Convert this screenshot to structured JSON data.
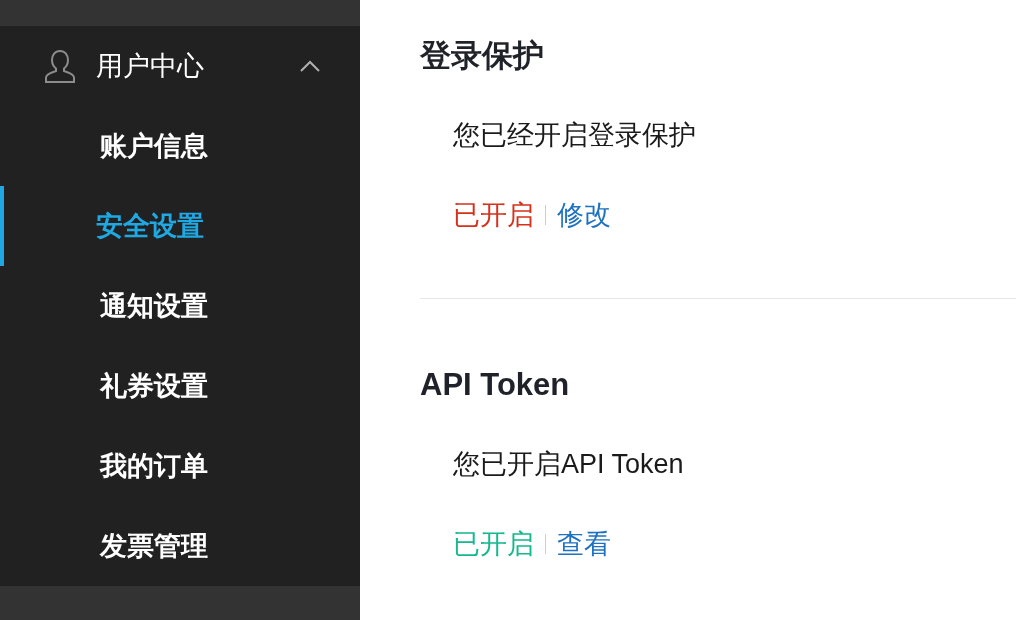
{
  "sidebar": {
    "group": {
      "label": "用户中心",
      "expanded": true,
      "items": [
        {
          "label": "账户信息",
          "selected": false
        },
        {
          "label": "安全设置",
          "selected": true
        },
        {
          "label": "通知设置",
          "selected": false
        },
        {
          "label": "礼券设置",
          "selected": false
        },
        {
          "label": "我的订单",
          "selected": false
        },
        {
          "label": "发票管理",
          "selected": false
        }
      ]
    }
  },
  "sections": [
    {
      "title": "登录保护",
      "description": "您已经开启登录保护",
      "status": {
        "text": "已开启",
        "color": "#d4321c"
      },
      "action": "修改"
    },
    {
      "title": "API Token",
      "description": "您已开启API Token",
      "status": {
        "text": "已开启",
        "color": "#17b890"
      },
      "action": "查看"
    }
  ]
}
